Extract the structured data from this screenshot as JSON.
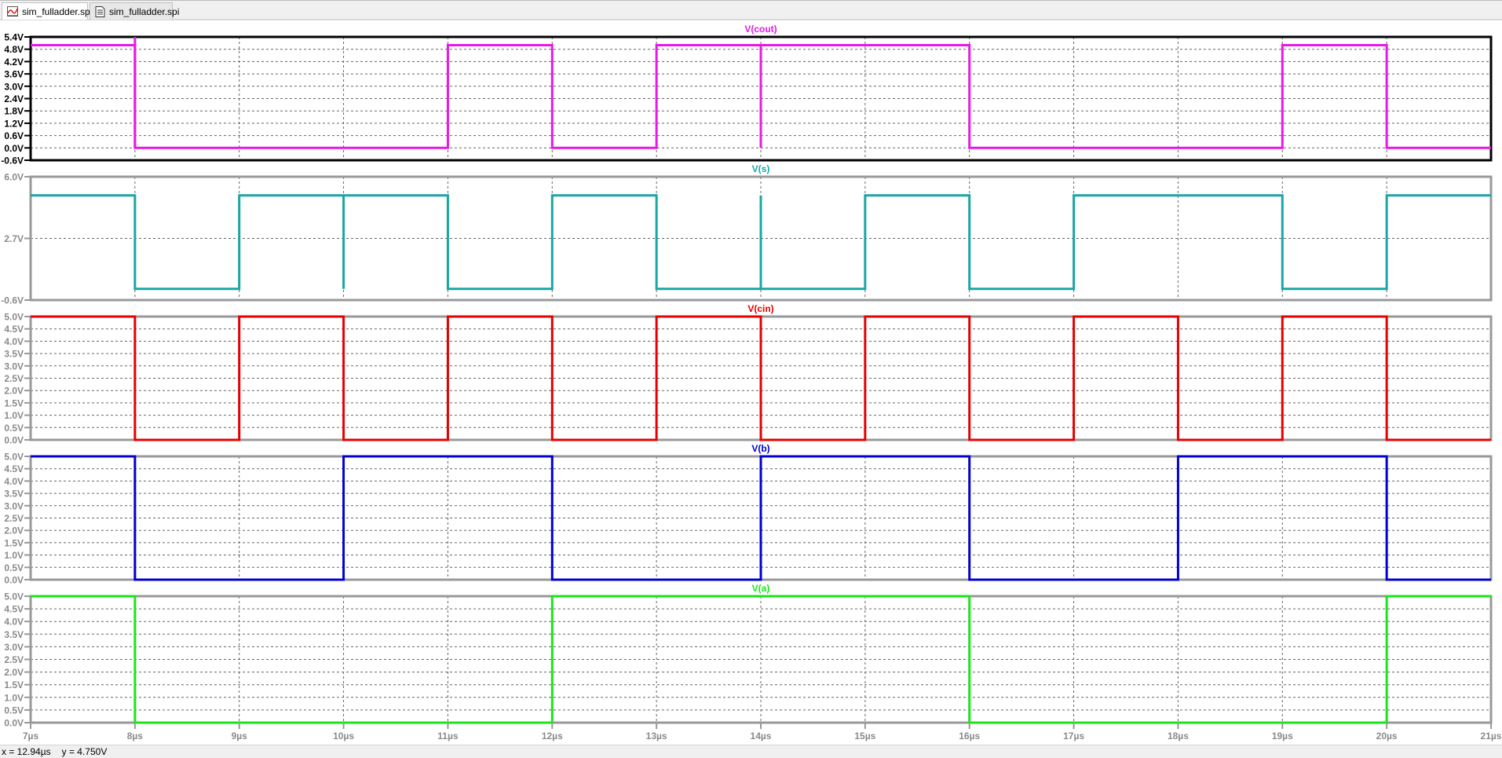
{
  "tabs": [
    {
      "label": "sim_fulladder.spi",
      "icon": "waveform-icon",
      "active": true
    },
    {
      "label": "sim_fulladder.spi",
      "icon": "netlist-document-icon",
      "active": false
    }
  ],
  "status": {
    "x_readout": "x = 12.94µs",
    "y_readout": "y = 4.750V"
  },
  "chart_data": {
    "type": "line",
    "xlabel": "",
    "xlim": [
      7,
      21
    ],
    "x_ticks": [
      "7µs",
      "8µs",
      "9µs",
      "10µs",
      "11µs",
      "12µs",
      "13µs",
      "14µs",
      "15µs",
      "16µs",
      "17µs",
      "18µs",
      "19µs",
      "20µs",
      "21µs"
    ],
    "grid": true,
    "panels": [
      {
        "title": "V(cout)",
        "color": "#e619e6",
        "active": true,
        "ylim": [
          -0.6,
          5.4
        ],
        "y_ticks": [
          "5.4V",
          "4.8V",
          "4.2V",
          "3.6V",
          "3.0V",
          "2.4V",
          "1.8V",
          "1.2V",
          "0.6V",
          "0.0V",
          "-0.6V"
        ],
        "y_tick_values": [
          5.4,
          4.8,
          4.2,
          3.6,
          3.0,
          2.4,
          1.8,
          1.2,
          0.6,
          0.0,
          -0.6
        ],
        "steps": [
          [
            7,
            5
          ],
          [
            8,
            0
          ],
          [
            11,
            5
          ],
          [
            12,
            0
          ],
          [
            13,
            5
          ],
          [
            16,
            0
          ],
          [
            19,
            5
          ],
          [
            20,
            0
          ]
        ],
        "glitches": [
          [
            14,
            0
          ],
          [
            8,
            5.4
          ]
        ]
      },
      {
        "title": "V(s)",
        "color": "#19a6a6",
        "active": false,
        "ylim": [
          -0.6,
          6.0
        ],
        "y_ticks": [
          "6.0V",
          "2.7V",
          "-0.6V"
        ],
        "y_tick_values": [
          6.0,
          2.7,
          -0.6
        ],
        "steps": [
          [
            7,
            5
          ],
          [
            8,
            0
          ],
          [
            9,
            5
          ],
          [
            11,
            0
          ],
          [
            12,
            5
          ],
          [
            13,
            0
          ],
          [
            15,
            5
          ],
          [
            16,
            0
          ],
          [
            17,
            5
          ],
          [
            19,
            0
          ],
          [
            20,
            5
          ]
        ],
        "glitches": [
          [
            14,
            5
          ],
          [
            10,
            0
          ]
        ]
      },
      {
        "title": "V(cin)",
        "color": "#e60000",
        "active": false,
        "ylim": [
          0,
          5
        ],
        "y_ticks": [
          "5.0V",
          "4.5V",
          "4.0V",
          "3.5V",
          "3.0V",
          "2.5V",
          "2.0V",
          "1.5V",
          "1.0V",
          "0.5V",
          "0.0V"
        ],
        "y_tick_values": [
          5,
          4.5,
          4,
          3.5,
          3,
          2.5,
          2,
          1.5,
          1,
          0.5,
          0
        ],
        "steps": [
          [
            7,
            5
          ],
          [
            8,
            0
          ],
          [
            9,
            5
          ],
          [
            10,
            0
          ],
          [
            11,
            5
          ],
          [
            12,
            0
          ],
          [
            13,
            5
          ],
          [
            14,
            0
          ],
          [
            15,
            5
          ],
          [
            16,
            0
          ],
          [
            17,
            5
          ],
          [
            18,
            0
          ],
          [
            19,
            5
          ],
          [
            20,
            0
          ]
        ],
        "glitches": []
      },
      {
        "title": "V(b)",
        "color": "#0000d0",
        "active": false,
        "ylim": [
          0,
          5
        ],
        "y_ticks": [
          "5.0V",
          "4.5V",
          "4.0V",
          "3.5V",
          "3.0V",
          "2.5V",
          "2.0V",
          "1.5V",
          "1.0V",
          "0.5V",
          "0.0V"
        ],
        "y_tick_values": [
          5,
          4.5,
          4,
          3.5,
          3,
          2.5,
          2,
          1.5,
          1,
          0.5,
          0
        ],
        "steps": [
          [
            7,
            5
          ],
          [
            8,
            0
          ],
          [
            10,
            5
          ],
          [
            12,
            0
          ],
          [
            14,
            5
          ],
          [
            16,
            0
          ],
          [
            18,
            5
          ],
          [
            20,
            0
          ]
        ],
        "glitches": []
      },
      {
        "title": "V(a)",
        "color": "#19e619",
        "active": false,
        "ylim": [
          0,
          5
        ],
        "y_ticks": [
          "5.0V",
          "4.5V",
          "4.0V",
          "3.5V",
          "3.0V",
          "2.5V",
          "2.0V",
          "1.5V",
          "1.0V",
          "0.5V",
          "0.0V"
        ],
        "y_tick_values": [
          5,
          4.5,
          4,
          3.5,
          3,
          2.5,
          2,
          1.5,
          1,
          0.5,
          0
        ],
        "steps": [
          [
            7,
            5
          ],
          [
            8,
            0
          ],
          [
            12,
            5
          ],
          [
            16,
            0
          ],
          [
            20,
            5
          ]
        ],
        "glitches": []
      }
    ]
  }
}
